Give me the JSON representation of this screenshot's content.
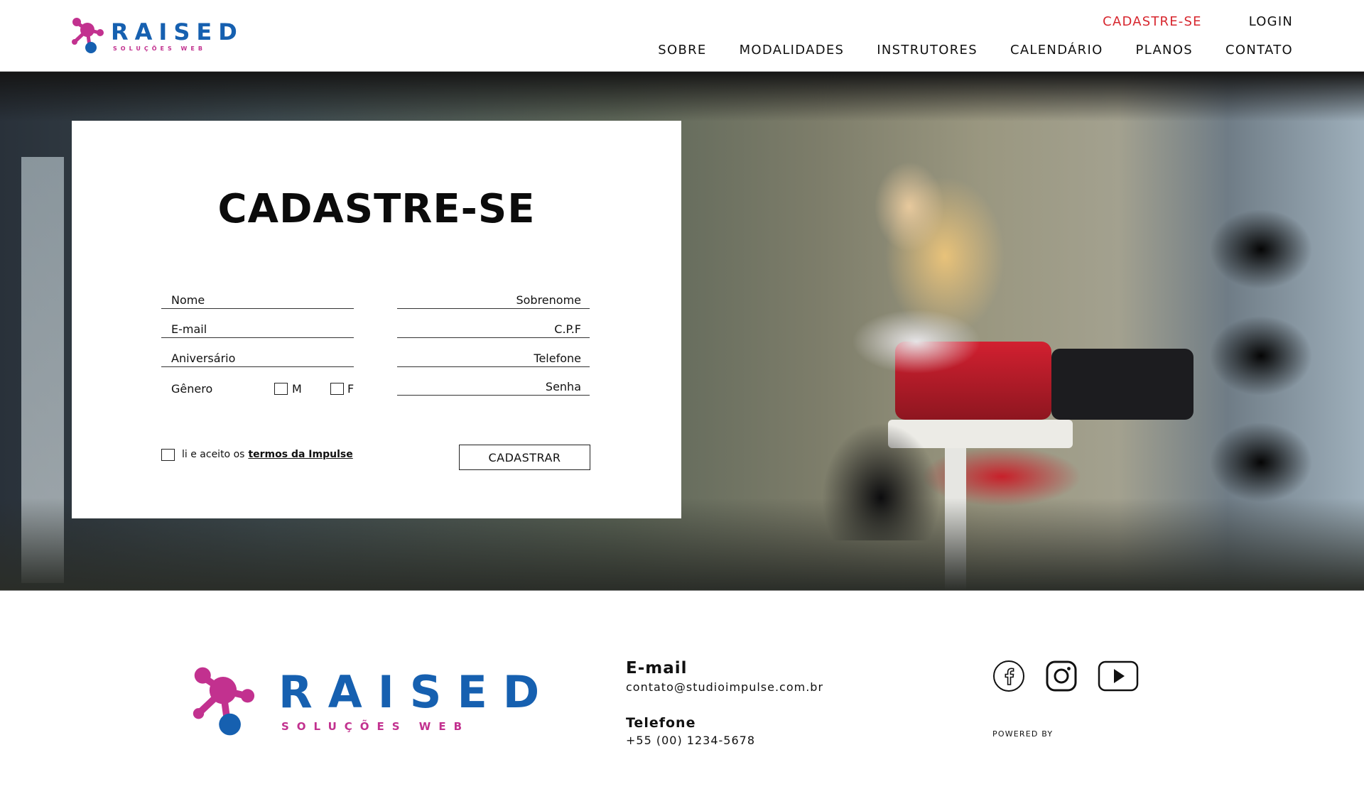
{
  "brand": {
    "name": "RAISED",
    "tagline": "SOLUÇÕES WEB",
    "colors": {
      "blue": "#1660b0",
      "magenta": "#c2318f",
      "accent_red": "#d7262e"
    }
  },
  "header": {
    "signup_link": "CADASTRE-SE",
    "login_link": "LOGIN",
    "nav": [
      "SOBRE",
      "MODALIDADES",
      "INSTRUTORES",
      "CALENDÁRIO",
      "PLANOS",
      "CONTATO"
    ]
  },
  "form": {
    "title": "CADASTRE-SE",
    "fields_left": [
      "Nome",
      "E-mail",
      "Aniversário"
    ],
    "fields_right": [
      "Sobrenome",
      "C.P.F",
      "Telefone",
      "Senha"
    ],
    "gender_label": "Gênero",
    "gender_options": [
      "M",
      "F"
    ],
    "terms_prefix": "li e aceito os",
    "terms_link": "termos da Impulse",
    "submit_label": "CADASTRAR"
  },
  "footer": {
    "email_heading": "E-mail",
    "email_value": "contato@studioimpulse.com.br",
    "phone_heading": "Telefone",
    "phone_value": "+55 (00) 1234-5678",
    "social_icons": [
      "facebook-icon",
      "instagram-icon",
      "youtube-icon"
    ],
    "powered_by": "POWERED BY"
  }
}
